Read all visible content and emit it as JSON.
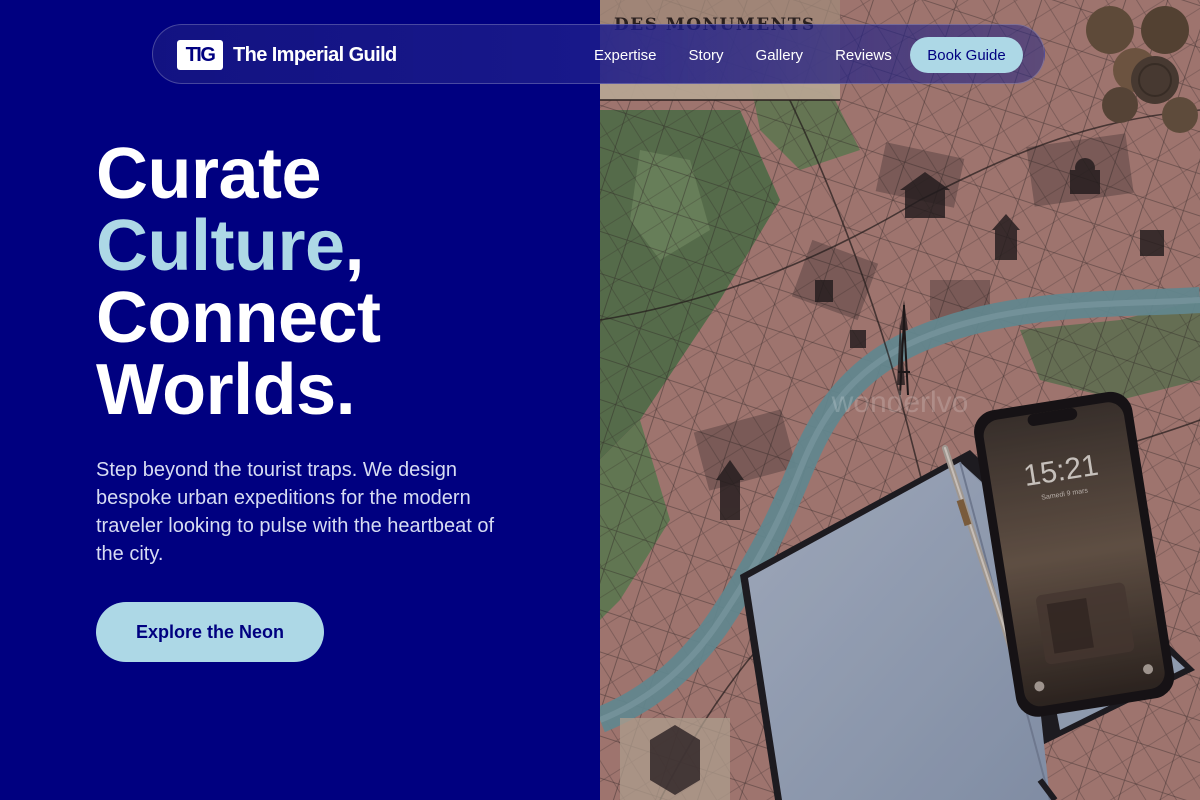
{
  "brand": {
    "logo_mark": "TIG",
    "name": "The Imperial Guild"
  },
  "nav": {
    "links": [
      "Expertise",
      "Story",
      "Gallery",
      "Reviews"
    ],
    "cta_label": "Book Guide"
  },
  "hero": {
    "headline_line1": "Curate",
    "headline_accent": "Culture",
    "headline_comma": ",",
    "headline_line3": "Connect",
    "headline_line4": "Worlds.",
    "subtext": "Step beyond the tourist traps. We design bespoke urban expeditions for the modern traveler looking to pulse with the heartbeat of the city.",
    "cta_label": "Explore the Neon"
  },
  "photo": {
    "map_heading": "DES MONUMENTS",
    "phone_time": "15:21",
    "phone_date": "Samedi 9 mars",
    "watermark": "wonderlvo"
  },
  "colors": {
    "background": "#000080",
    "accent": "#add8e6",
    "text": "#ffffff"
  }
}
